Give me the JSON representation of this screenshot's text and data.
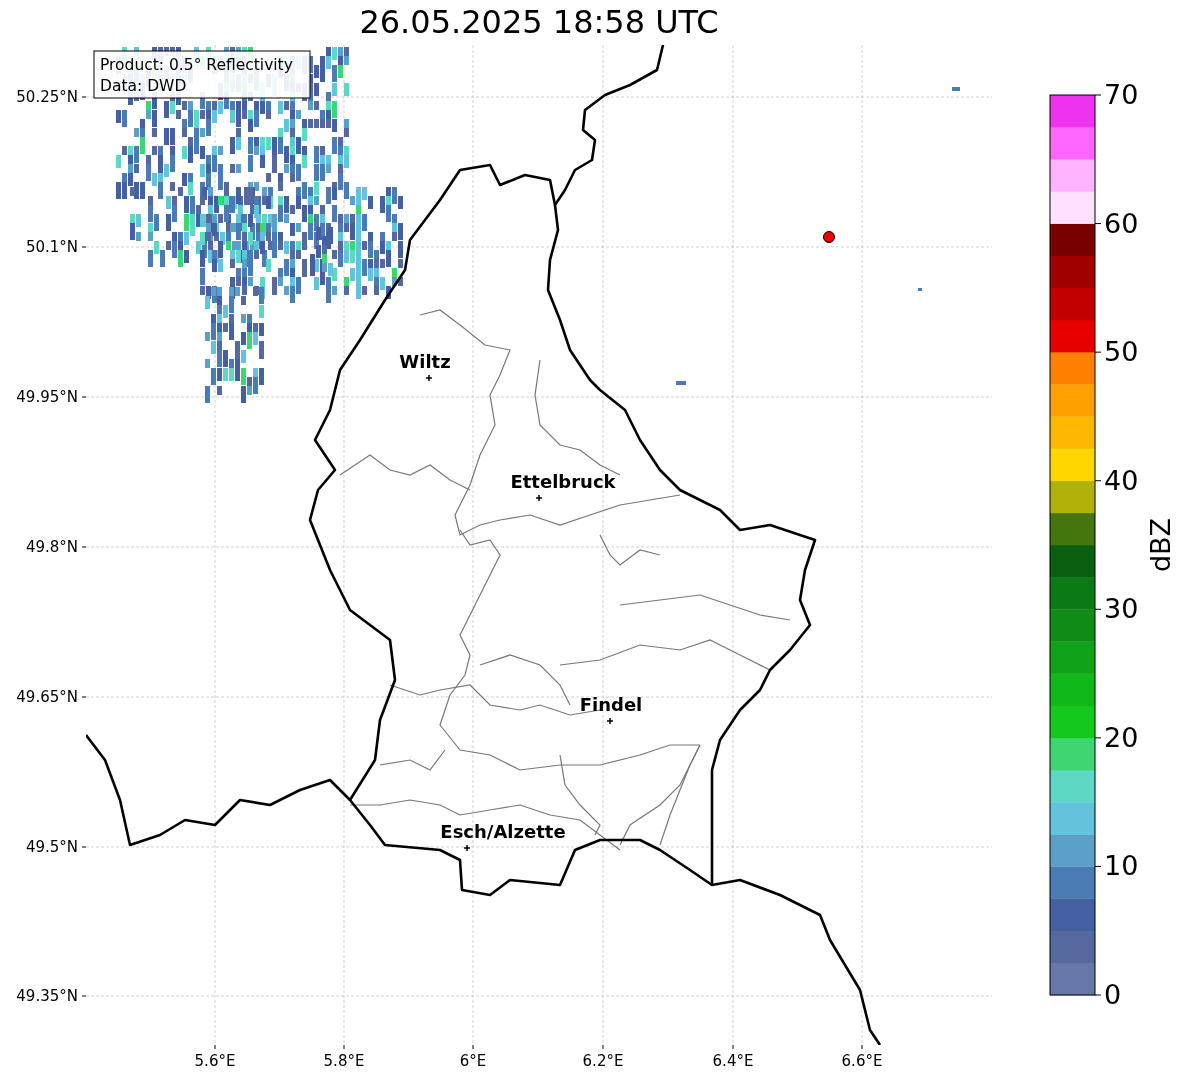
{
  "title": "26.05.2025 18:58 UTC",
  "info_box": [
    "Product: 0.5° Reflectivity",
    "Data: DWD"
  ],
  "map": {
    "lat_ticks": [
      "50.25°N",
      "50.1°N",
      "49.95°N",
      "49.8°N",
      "49.65°N",
      "49.5°N",
      "49.35°N"
    ],
    "lon_ticks": [
      "5.6°E",
      "5.8°E",
      "6°E",
      "6.2°E",
      "6.4°E",
      "6.6°E"
    ],
    "cities": [
      {
        "name": "Wiltz"
      },
      {
        "name": "Ettelbruck"
      },
      {
        "name": "Findel"
      },
      {
        "name": "Esch/Alzette"
      }
    ]
  },
  "colorbar": {
    "label": "dBZ",
    "ticks": [
      "70",
      "60",
      "50",
      "40",
      "30",
      "20",
      "10",
      "0"
    ],
    "bins": [
      {
        "color": "#6677a8"
      },
      {
        "color": "#56699f"
      },
      {
        "color": "#4460a0"
      },
      {
        "color": "#4a7bb3"
      },
      {
        "color": "#5aa0c8"
      },
      {
        "color": "#63c2dc"
      },
      {
        "color": "#5cd8c4"
      },
      {
        "color": "#3ed672"
      },
      {
        "color": "#14c91e"
      },
      {
        "color": "#11b81a"
      },
      {
        "color": "#10a31a"
      },
      {
        "color": "#0f8c18"
      },
      {
        "color": "#0c7a14"
      },
      {
        "color": "#0a5e10"
      },
      {
        "color": "#45760e"
      },
      {
        "color": "#b0b20a"
      },
      {
        "color": "#ffd700"
      },
      {
        "color": "#ffb800"
      },
      {
        "color": "#ff9f00"
      },
      {
        "color": "#ff8000"
      },
      {
        "color": "#e60000"
      },
      {
        "color": "#c20000"
      },
      {
        "color": "#a00000"
      },
      {
        "color": "#780000"
      },
      {
        "color": "#ffe0ff"
      },
      {
        "color": "#ffb3ff"
      },
      {
        "color": "#ff66ff"
      },
      {
        "color": "#ee33ee"
      }
    ]
  }
}
